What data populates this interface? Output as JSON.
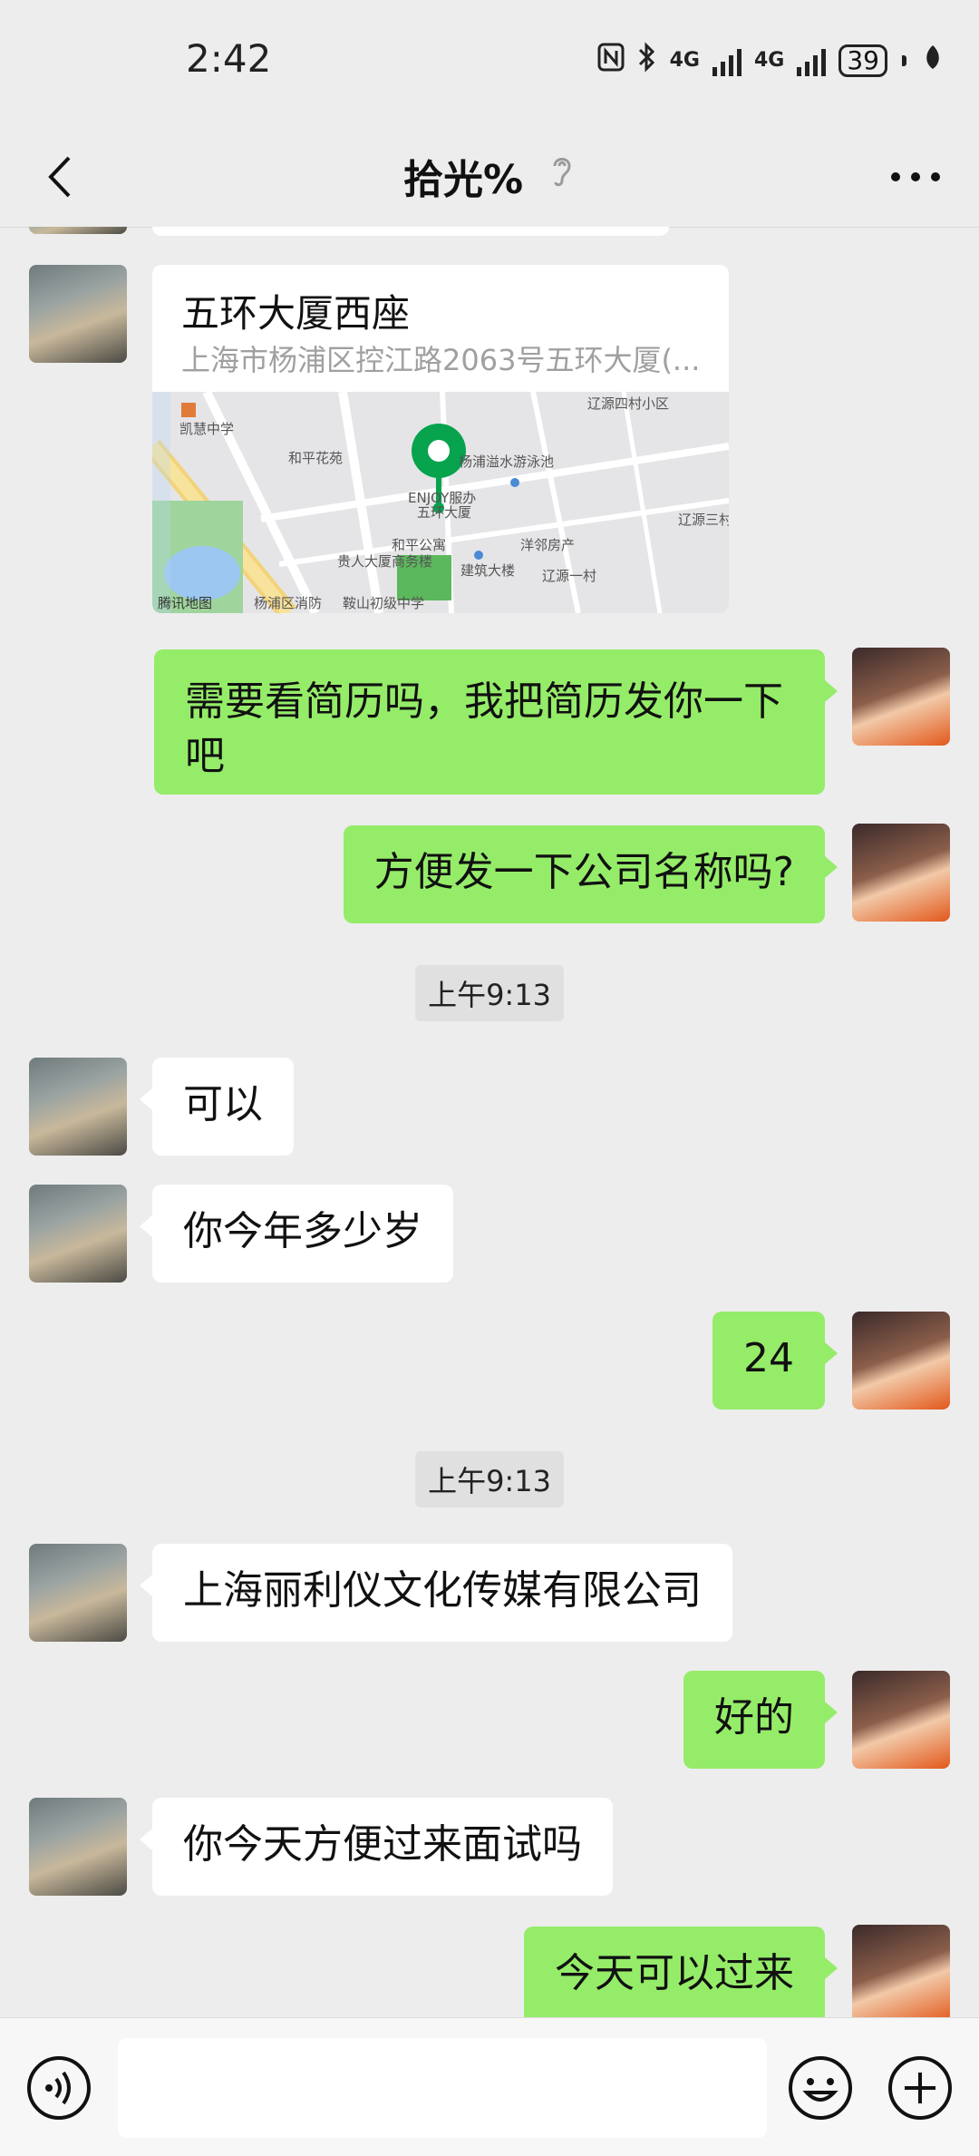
{
  "status_bar": {
    "time": "2:42",
    "net1": "4G",
    "net2": "4G",
    "battery": "39"
  },
  "header": {
    "title": "拾光%"
  },
  "location": {
    "name": "五环大厦西座",
    "address": "上海市杨浦区控江路2063号五环大厦(...",
    "map_labels": [
      "辽源四村小区",
      "凯慧中学",
      "和平花苑",
      "杨浦溢水游泳池",
      "ENJOY服办",
      "五环大厦",
      "洋邻房产",
      "和平公寓",
      "贵人大厦商务楼",
      "建筑大楼",
      "辽源一村",
      "鞍山初级中学",
      "杨浦区消防",
      "辽源三村",
      "腾讯地图"
    ]
  },
  "messages": [
    {
      "side": "right",
      "text": "需要看简历吗，我把简历发你一下",
      "text2": "吧"
    },
    {
      "side": "right",
      "text": "方便发一下公司名称吗?"
    },
    {
      "type": "time",
      "text": "上午9:13"
    },
    {
      "side": "left",
      "text": "可以"
    },
    {
      "side": "left",
      "text": "你今年多少岁"
    },
    {
      "side": "right",
      "text": "24"
    },
    {
      "type": "time",
      "text": "上午9:13"
    },
    {
      "side": "left",
      "text": "上海丽利仪文化传媒有限公司"
    },
    {
      "side": "right",
      "text": "好的"
    },
    {
      "side": "left",
      "text": "你今天方便过来面试吗"
    },
    {
      "side": "right",
      "text": "今天可以过来"
    }
  ],
  "colors": {
    "bg": "#ededed",
    "bubble_green": "#95ec69",
    "bubble_white": "#ffffff"
  }
}
